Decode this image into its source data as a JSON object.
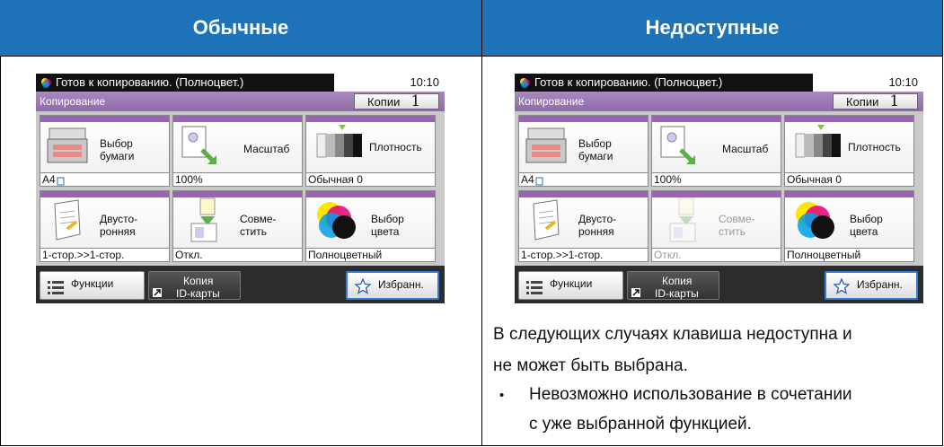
{
  "headers": {
    "normal": "Обычные",
    "unavailable": "Недоступные"
  },
  "panels": [
    {
      "status": "Готов к копированию. (Полноцвет.)",
      "time": "10:10",
      "mode": "Копирование",
      "copies_label": "Копии",
      "copies_value": "1",
      "functions": [
        {
          "label": "Выбор\nбумаги",
          "value": "A4",
          "disabled": false
        },
        {
          "label": "Масштаб",
          "value": "100%",
          "disabled": false
        },
        {
          "label": "Плотность",
          "value": "Обычная 0",
          "disabled": false
        },
        {
          "label": "Двусто-\nронняя",
          "value": "1-стор.>>1-стор.",
          "disabled": false
        },
        {
          "label": "Совме-\nстить",
          "value": "Откл.",
          "disabled": false
        },
        {
          "label": "Выбор\nцвета",
          "value": "Полноцветный",
          "disabled": false
        }
      ],
      "bottom": {
        "functions": "Функции",
        "id_copy_1": "Копия",
        "id_copy_2": "ID-карты",
        "favorites": "Избранн."
      }
    },
    {
      "status": "Готов к копированию. (Полноцвет.)",
      "time": "10:10",
      "mode": "Копирование",
      "copies_label": "Копии",
      "copies_value": "1",
      "functions": [
        {
          "label": "Выбор\nбумаги",
          "value": "A4",
          "disabled": false
        },
        {
          "label": "Масштаб",
          "value": "100%",
          "disabled": false
        },
        {
          "label": "Плотность",
          "value": "Обычная 0",
          "disabled": false
        },
        {
          "label": "Двусто-\nронняя",
          "value": "1-стор.>>1-стор.",
          "disabled": false
        },
        {
          "label": "Совме-\nстить",
          "value": "Откл.",
          "disabled": true
        },
        {
          "label": "Выбор\nцвета",
          "value": "Полноцветный",
          "disabled": false
        }
      ],
      "bottom": {
        "functions": "Функции",
        "id_copy_1": "Копия",
        "id_copy_2": "ID-карты",
        "favorites": "Избранн."
      }
    }
  ],
  "note": {
    "line1": "В следующих случаях клавиша недоступна и",
    "line2": "не может быть выбрана.",
    "bullet": "•",
    "item_line1": "Невозможно использование в сочетании",
    "item_line2": "с уже выбранной функцией."
  }
}
